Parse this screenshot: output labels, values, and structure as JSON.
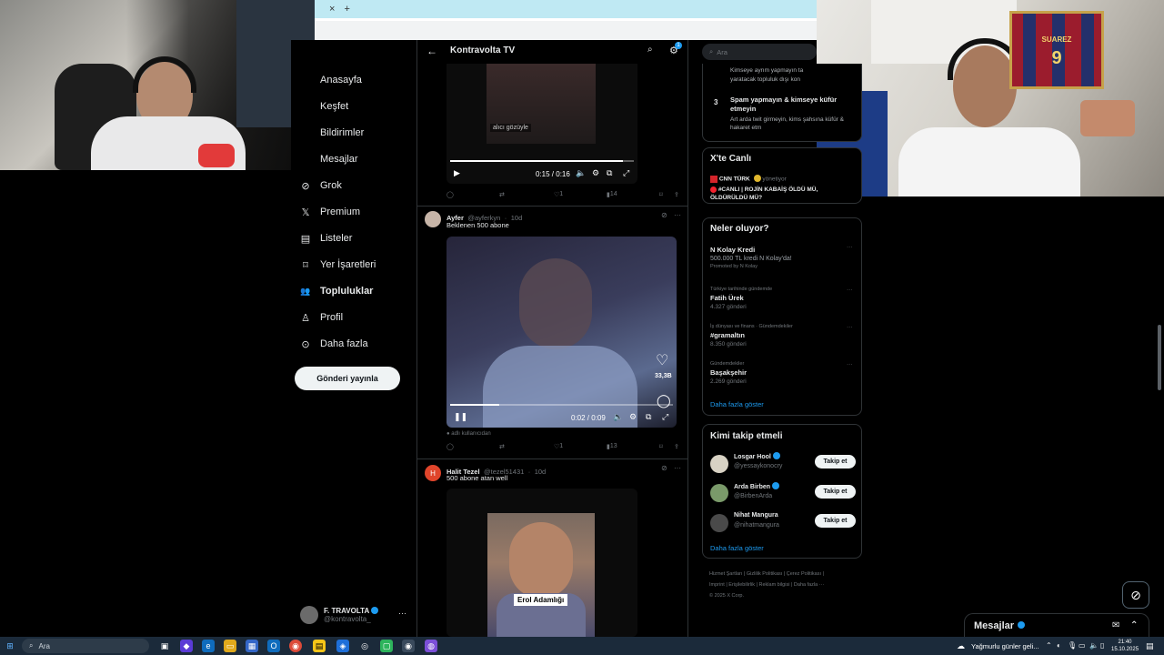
{
  "browser": {
    "tab_close": "×",
    "tab_new": "+"
  },
  "nav": {
    "items": [
      {
        "label": "Anasayfa",
        "icon": "home-icon",
        "glyph": ""
      },
      {
        "label": "Keşfet",
        "icon": "explore-icon",
        "glyph": ""
      },
      {
        "label": "Bildirimler",
        "icon": "bell-icon",
        "glyph": ""
      },
      {
        "label": "Mesajlar",
        "icon": "mail-icon",
        "glyph": ""
      },
      {
        "label": "Grok",
        "icon": "grok-icon",
        "glyph": "⊘"
      },
      {
        "label": "Premium",
        "icon": "x-logo-icon",
        "glyph": "𝕏"
      },
      {
        "label": "Listeler",
        "icon": "list-icon",
        "glyph": "▤"
      },
      {
        "label": "Yer İşaretleri",
        "icon": "bookmark-icon",
        "glyph": "⌑"
      },
      {
        "label": "Topluluklar",
        "icon": "communities-icon",
        "glyph": "👥"
      },
      {
        "label": "Profil",
        "icon": "person-icon",
        "glyph": "♙"
      },
      {
        "label": "Daha fazla",
        "icon": "more-circle-icon",
        "glyph": "⊙"
      }
    ],
    "post_button": "Gönderi yayınla",
    "account": {
      "name": "F. TRAVOLTA",
      "handle": "@kontravolta_",
      "more": "···"
    }
  },
  "header": {
    "back": "←",
    "title": "Kontravolta TV",
    "search_glyph": "⌕",
    "settings_glyph": "⚙",
    "badge": "1"
  },
  "tweets": {
    "first": {
      "overlay_top": "alıcı gözüyle",
      "time": "0:15 / 0:16",
      "progress": 0.94,
      "stats": {
        "likes": "1",
        "views": "14"
      }
    },
    "second": {
      "name": "Ayfer",
      "handle": "@ayferkyn",
      "age": "10d",
      "text": "Beklenen 500 abone",
      "time": "0:02 / 0:09",
      "progress": 0.22,
      "side_likes": "33,3B",
      "caption": "adlı kullanıcıdan",
      "stats": {
        "likes": "1",
        "views": "13"
      }
    },
    "third": {
      "name": "Halit Tezel",
      "handle": "@tezel51431",
      "age": "10d",
      "text": "500 abone atan well",
      "avatar_letter": "H",
      "image_caption": "Erol Adamlığı"
    }
  },
  "sidebar": {
    "search_placeholder": "Ara",
    "rules": {
      "partial1": "Kimseye ayrım yapmayın ta",
      "partial2": "yaratacak topluluk dışı kon",
      "num": "3",
      "title": "Spam yapmayın & kimseye küfür etmeyin",
      "desc": "Art arda twit girmeyin, kims şahsına küfür & hakaret etm"
    },
    "live": {
      "title": "X'te Canlı",
      "source": "CNN TÜRK",
      "status": "yönetiyor",
      "headline": "#CANLI | ROJİN KABAİŞ ÖLDÜ MÜ, ÖLDÜRÜLDÜ MÜ?"
    },
    "trends": {
      "title": "Neler oluyor?",
      "items": [
        {
          "context": "",
          "name": "N Kolay Kredi",
          "count": "500.000 TL kredi N Kolay'da!",
          "extra": "Promoted by N Kolay"
        },
        {
          "context": "Türkiye tarihinde gündemde",
          "name": "Fatih Ürek",
          "count": "4.327 gönderi",
          "extra": ""
        },
        {
          "context": "İş dünyası ve finans · Gündemdekiler",
          "name": "#gramaltın",
          "count": "8.350 gönderi",
          "extra": ""
        },
        {
          "context": "Gündemdekiler",
          "name": "Başakşehir",
          "count": "2.269 gönderi",
          "extra": ""
        }
      ],
      "show_more": "Daha fazla göster"
    },
    "who_to_follow": {
      "title": "Kimi takip etmeli",
      "users": [
        {
          "name": "Losgar Hool",
          "handle": "@yessaykonocry",
          "button": "Takip et"
        },
        {
          "name": "Arda Birben",
          "handle": "@BirbenArda",
          "button": "Takip et"
        },
        {
          "name": "Nihat Mangura",
          "handle": "@nihatmangura",
          "button": "Takip et"
        }
      ],
      "show_more": "Daha fazla göster"
    },
    "footer": {
      "line1": "Hizmet Şartları  |  Gizlilik Politikası  |  Çerez Politikası  |",
      "line2": "Imprint  |  Erişilebilirlik  |  Reklam bilgisi  |  Daha fazla ···",
      "line3": "© 2025 X Corp."
    }
  },
  "messages_dock": {
    "label": "Mesajlar"
  },
  "taskbar": {
    "search": "Ara",
    "weather": "Yağmurlu günler geli...",
    "time": "21:40",
    "date": "15.10.2025"
  },
  "webcam": {
    "jersey_name": "SUAREZ",
    "jersey_number": "9"
  }
}
